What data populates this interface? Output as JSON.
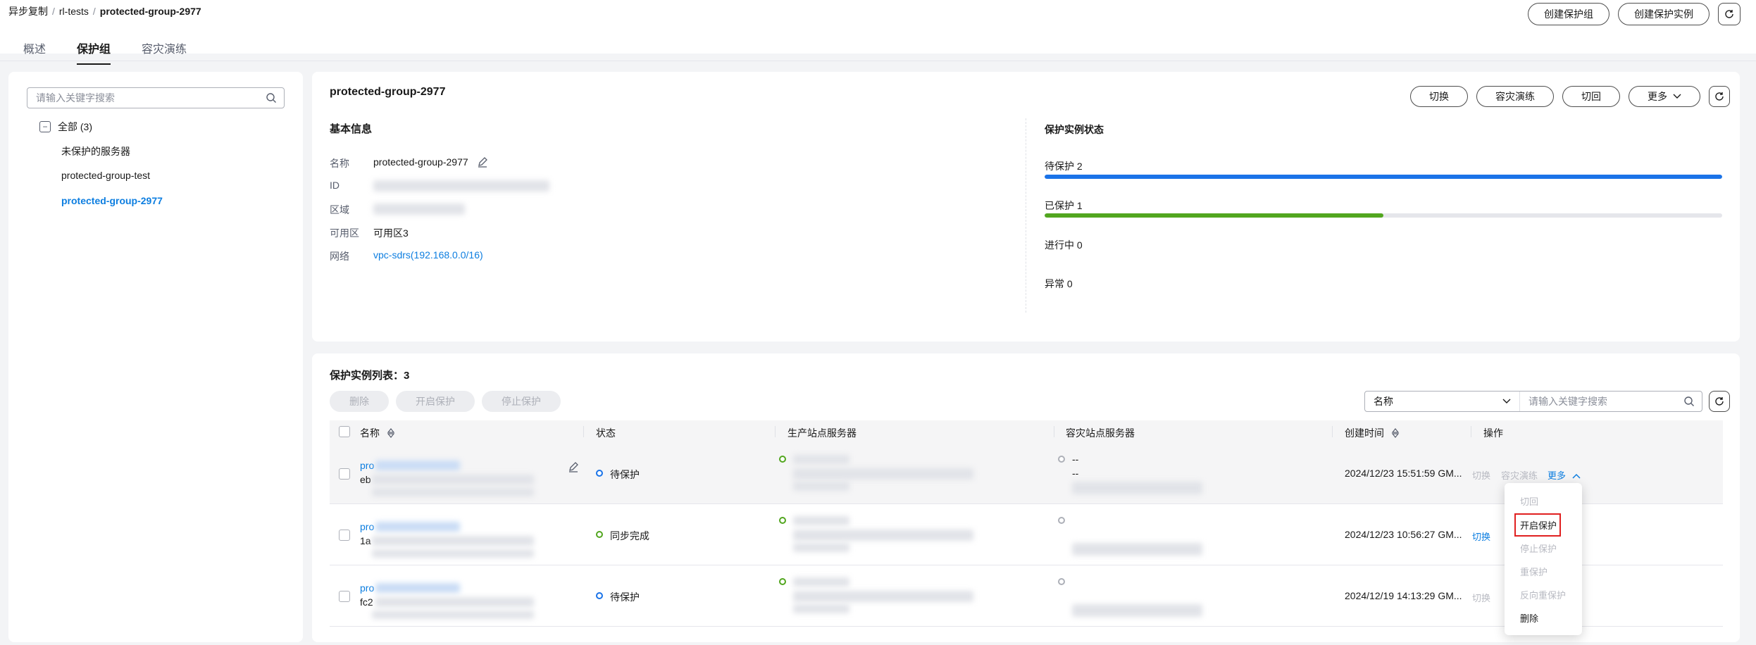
{
  "breadcrumb": [
    "异步复制",
    "rl-tests",
    "protected-group-2977"
  ],
  "top_actions": {
    "create_group": "创建保护组",
    "create_instance": "创建保护实例"
  },
  "tabs": [
    "概述",
    "保护组",
    "容灾演练"
  ],
  "sidebar": {
    "search_placeholder": "请输入关键字搜索",
    "root_label": "全部 (3)",
    "items": [
      "未保护的服务器",
      "protected-group-test",
      "protected-group-2977"
    ]
  },
  "detail": {
    "title": "protected-group-2977",
    "actions": {
      "switch": "切换",
      "drill": "容灾演练",
      "failback": "切回",
      "more": "更多"
    },
    "basic_info_title": "基本信息",
    "fields": {
      "name_label": "名称",
      "name_value": "protected-group-2977",
      "id_label": "ID",
      "region_label": "区域",
      "az_label": "可用区",
      "az_value": "可用区3",
      "network_label": "网络",
      "network_value": "vpc-sdrs(192.168.0.0/16)"
    },
    "status_title": "保护实例状态",
    "status": [
      {
        "label": "待保护 2",
        "fraction": 1.0,
        "color": "#1a73e8"
      },
      {
        "label": "已保护 1",
        "fraction": 0.5,
        "color": "#52a61f"
      },
      {
        "label": "进行中 0"
      },
      {
        "label": "异常 0"
      }
    ]
  },
  "list": {
    "title": "保护实例列表：3",
    "actions": {
      "delete": "删除",
      "start": "开启保护",
      "stop": "停止保护"
    },
    "filter": {
      "field": "名称",
      "placeholder": "请输入关键字搜索"
    },
    "headers": {
      "name": "名称",
      "status": "状态",
      "prod": "生产站点服务器",
      "dr": "容灾站点服务器",
      "created": "创建时间",
      "ops": "操作"
    },
    "rows": [
      {
        "name_prefix": "pro",
        "id_prefix": "eb",
        "status": "待保护",
        "status_color": "#1a73e8",
        "prod_dot": "#52a61f",
        "dr_dot": "#adb0b8",
        "dr_text": "--",
        "dr_text2": "--",
        "created": "2024/12/23 15:51:59 GM..."
      },
      {
        "name_prefix": "pro",
        "id_prefix": "1a",
        "status": "同步完成",
        "status_color": "#52a61f",
        "prod_dot": "#52a61f",
        "dr_dot": "#adb0b8",
        "created": "2024/12/23 10:56:27 GM..."
      },
      {
        "name_prefix": "pro",
        "id_prefix": "fc2",
        "status": "待保护",
        "status_color": "#1a73e8",
        "prod_dot": "#52a61f",
        "dr_dot": "#adb0b8",
        "created": "2024/12/19 14:13:29 GM..."
      }
    ],
    "row_ops": {
      "switch": "切换",
      "drill": "容灾演练",
      "more": "更多"
    },
    "dropdown": [
      "切回",
      "开启保护",
      "停止保护",
      "重保护",
      "反向重保护",
      "删除"
    ]
  }
}
